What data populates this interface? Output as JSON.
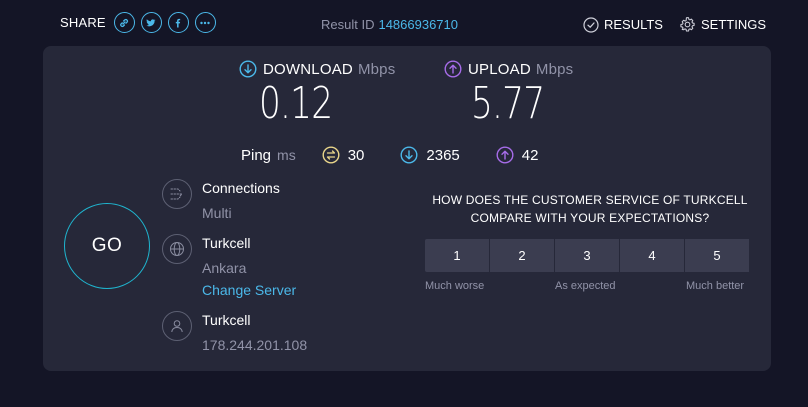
{
  "header": {
    "share_label": "SHARE",
    "share_buttons": [
      "link-icon",
      "twitter-icon",
      "facebook-icon",
      "more-icon"
    ],
    "result_id_label": "Result ID",
    "result_id_value": "14866936710",
    "results_label": "RESULTS",
    "settings_label": "SETTINGS"
  },
  "metrics": {
    "download": {
      "label": "DOWNLOAD",
      "unit": "Mbps",
      "value": "0.12",
      "icon": "download-arrow-icon",
      "color": "#4bb8e9"
    },
    "upload": {
      "label": "UPLOAD",
      "unit": "Mbps",
      "value": "5.77",
      "icon": "upload-arrow-icon",
      "color": "#a66ce8"
    }
  },
  "ping": {
    "label": "Ping",
    "unit": "ms",
    "idle": "30",
    "download": "2365",
    "upload": "42",
    "colors": {
      "idle": "#e8d58a",
      "download": "#4bb8e9",
      "upload": "#a66ce8"
    }
  },
  "go_label": "GO",
  "connections": {
    "title": "Connections",
    "value": "Multi"
  },
  "server": {
    "title": "Turkcell",
    "location": "Ankara",
    "change_label": "Change Server"
  },
  "provider": {
    "title": "Turkcell",
    "ip": "178.244.201.108"
  },
  "survey": {
    "question_line1": "HOW DOES THE CUSTOMER SERVICE OF TURKCELL",
    "question_line2": "COMPARE WITH YOUR EXPECTATIONS?",
    "options": [
      "1",
      "2",
      "3",
      "4",
      "5"
    ],
    "label_low": "Much worse",
    "label_mid": "As expected",
    "label_high": "Much better"
  }
}
